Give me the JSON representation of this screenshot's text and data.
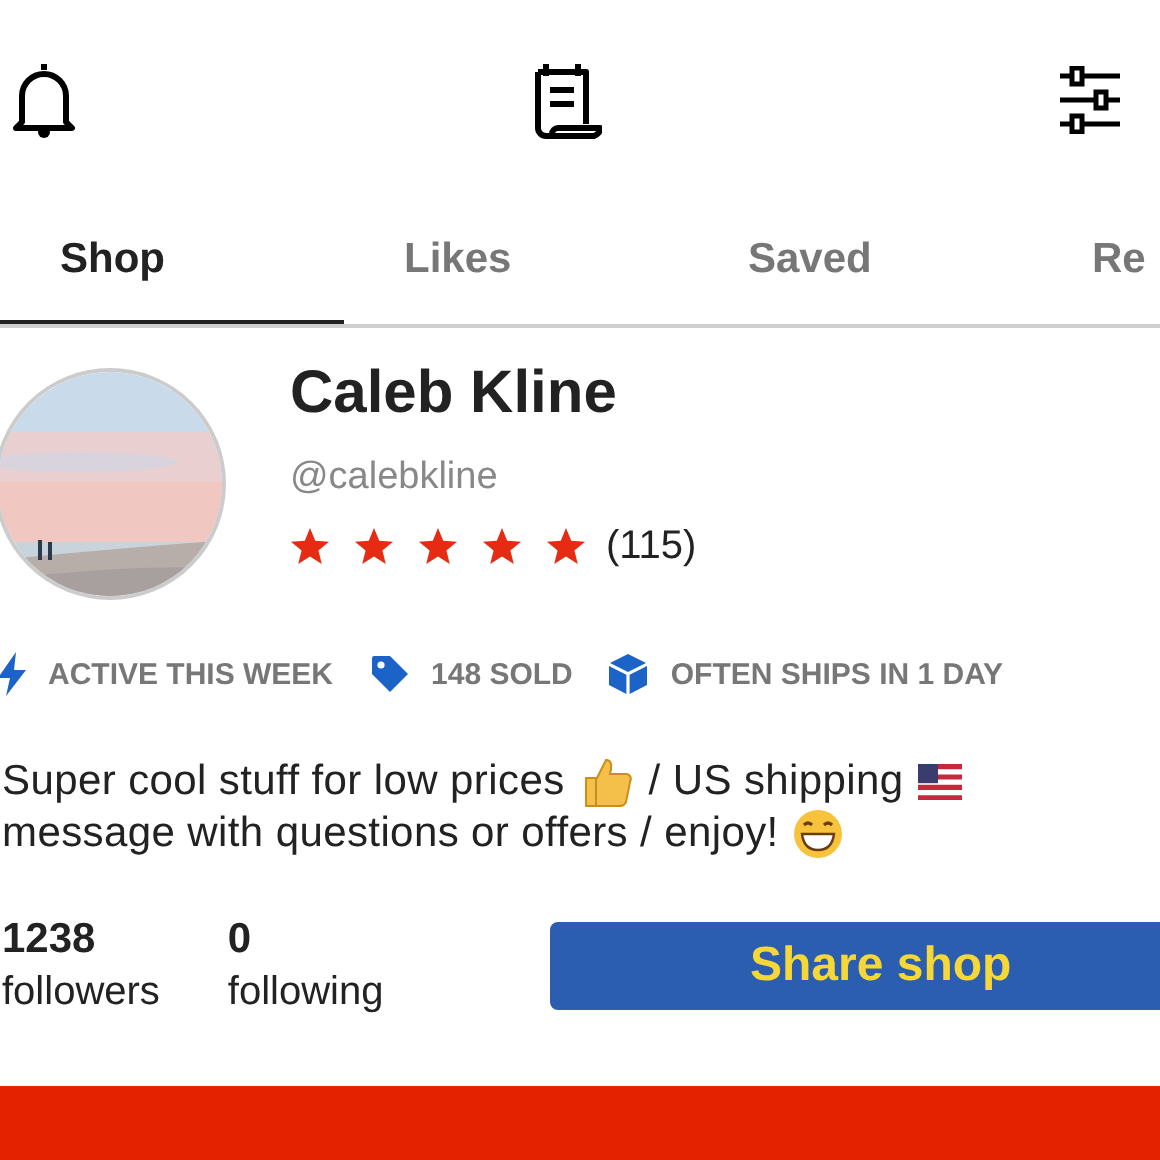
{
  "tabs": [
    {
      "label": "Shop",
      "selected": true
    },
    {
      "label": "Likes",
      "selected": false
    },
    {
      "label": "Saved",
      "selected": false
    },
    {
      "label": "Re",
      "selected": false
    }
  ],
  "profile": {
    "name": "Caleb Kline",
    "handle": "@calebkline",
    "stars": 5,
    "rating_count": "(115)"
  },
  "badges": [
    {
      "kind": "activity",
      "text": "ACTIVE THIS WEEK"
    },
    {
      "kind": "sold",
      "text": "148 SOLD"
    },
    {
      "kind": "shipping",
      "text": "OFTEN SHIPS IN 1 DAY"
    }
  ],
  "bio": [
    {
      "parts": [
        "Super cool stuff for low prices",
        "/ US shipping"
      ]
    },
    {
      "parts": [
        "message with questions or offers / enjoy!"
      ]
    }
  ],
  "stats": [
    {
      "value": "1238",
      "label": "followers"
    },
    {
      "value": "0",
      "label": "following"
    }
  ],
  "share_button": "Share shop"
}
